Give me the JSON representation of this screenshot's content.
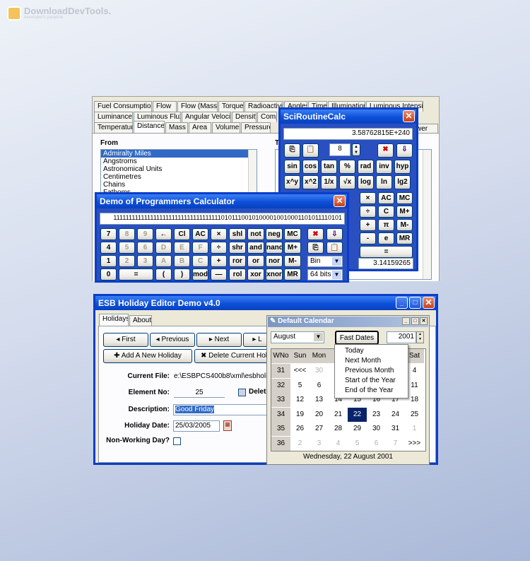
{
  "watermark": {
    "brand": "DownloadDevTools.",
    "tagline": "developer's paradise"
  },
  "converter": {
    "tabs_row1": [
      "Fuel Consumption",
      "Flow",
      "Flow (Mass)",
      "Torque",
      "Radioactivity",
      "Angles",
      "Time",
      "Illumination",
      "Luminous Intensity"
    ],
    "tabs_row2": [
      "Luminance",
      "Luminous Flux",
      "Angular Velocity",
      "Density",
      "Comp"
    ],
    "tabs_row3": [
      "Temperature",
      "Distance",
      "Mass",
      "Area",
      "Volume",
      "Pressure"
    ],
    "tab_row3_cut": "wer",
    "from_label": "From",
    "to_label": "T",
    "from_items": [
      "Admiralty Miles",
      "Angstroms",
      "Astronomical Units",
      "Centimetres",
      "Chains",
      "Fathoms"
    ]
  },
  "sci": {
    "title": "SciRoutineCalc",
    "display": "3.58762815E+240",
    "precision": "8",
    "row1": [
      "sin",
      "cos",
      "tan",
      "%",
      "rad",
      "inv",
      "hyp"
    ],
    "row2": [
      "x^y",
      "x^2",
      "1/x",
      "√x",
      "log",
      "ln",
      "lg2"
    ],
    "right_keys": [
      "×",
      "AC",
      "MC",
      "÷",
      "C",
      "M+",
      "+",
      "π",
      "M-",
      "-",
      "e",
      "MR",
      "="
    ],
    "pi_value": "3.14159265",
    "left_cut": "p"
  },
  "prog": {
    "title": "Demo of Programmers Calculator",
    "display": "1111111111111111111111111111111111101011100101000010010001101011110101",
    "rows": [
      [
        "7",
        "8",
        "9",
        "←",
        "Cl",
        "AC",
        "×",
        "shl",
        "not",
        "neg",
        "MC"
      ],
      [
        "4",
        "5",
        "6",
        "D",
        "E",
        "F",
        "÷",
        "shr",
        "and",
        "nand",
        "M+"
      ],
      [
        "1",
        "2",
        "3",
        "A",
        "B",
        "C",
        "+",
        "ror",
        "or",
        "nor",
        "M-"
      ],
      [
        "0",
        "=",
        "(",
        ")",
        "mod",
        "—",
        "rol",
        "xor",
        "xnor",
        "MR"
      ]
    ],
    "base": "Bin",
    "bits": "64 bits"
  },
  "holiday": {
    "title": "ESB Holiday Editor Demo v4.0",
    "tabs": [
      "Holidays",
      "About"
    ],
    "nav": [
      "First",
      "Previous",
      "Next",
      "L"
    ],
    "add_label": "Add A New Holiday",
    "delete_label": "Delete Current Hol",
    "current_file_label": "Current File:",
    "current_file": "e:\\ESBPCS400b8\\xml\\esbholida",
    "element_no_label": "Element No:",
    "element_no": "25",
    "delete_check_label": "Delet",
    "description_label": "Description:",
    "description": "Good Friday",
    "holiday_date_label": "Holiday Date:",
    "holiday_date": "25/03/2005",
    "non_working_label": "Non-Working Day?"
  },
  "calendar": {
    "title": "Default Calendar",
    "month": "August",
    "fast_dates": "Fast Dates",
    "year": "2001",
    "headers": [
      "WNo",
      "Sun",
      "Mon",
      "",
      "",
      "",
      "",
      "Sat"
    ],
    "menu": [
      "Today",
      "Next Month",
      "Previous Month",
      "Start of the Year",
      "End of the Year"
    ],
    "week_nos": [
      "31",
      "32",
      "33",
      "34",
      "35",
      "36"
    ],
    "rows": [
      [
        "<<<",
        "30",
        "",
        "",
        "",
        "",
        "4"
      ],
      [
        "5",
        "6",
        "",
        "",
        "",
        "",
        "11"
      ],
      [
        "12",
        "13",
        "14",
        "15",
        "16",
        "17",
        "18"
      ],
      [
        "19",
        "20",
        "21",
        "22",
        "23",
        "24",
        "25"
      ],
      [
        "26",
        "27",
        "28",
        "29",
        "30",
        "31",
        "1"
      ],
      [
        "2",
        "3",
        "4",
        "5",
        "6",
        "7",
        ">>>"
      ]
    ],
    "status": "Wednesday, 22 August 2001",
    "selected_day": "22"
  }
}
